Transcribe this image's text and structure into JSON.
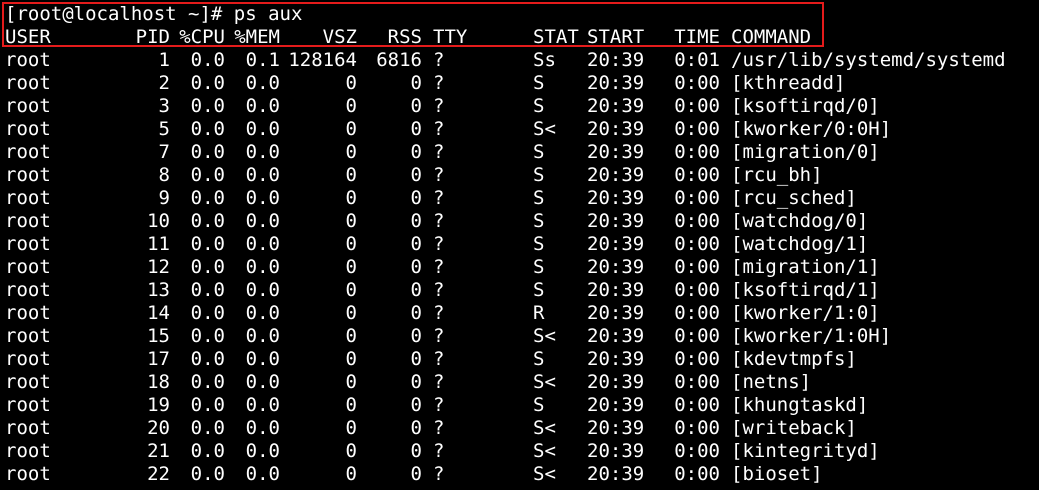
{
  "terminal": {
    "prompt": "[root@localhost ~]# ps aux",
    "headers": {
      "user": "USER",
      "pid": "PID",
      "cpu": "%CPU",
      "mem": "%MEM",
      "vsz": "VSZ",
      "rss": "RSS",
      "tty": "TTY",
      "stat": "STAT",
      "start": "START",
      "time": "TIME",
      "command": "COMMAND"
    },
    "rows": [
      {
        "user": "root",
        "pid": "1",
        "cpu": "0.0",
        "mem": "0.1",
        "vsz": "128164",
        "rss": "6816",
        "tty": "?",
        "stat": "Ss",
        "start": "20:39",
        "time": "0:01",
        "command": "/usr/lib/systemd/systemd"
      },
      {
        "user": "root",
        "pid": "2",
        "cpu": "0.0",
        "mem": "0.0",
        "vsz": "0",
        "rss": "0",
        "tty": "?",
        "stat": "S",
        "start": "20:39",
        "time": "0:00",
        "command": "[kthreadd]"
      },
      {
        "user": "root",
        "pid": "3",
        "cpu": "0.0",
        "mem": "0.0",
        "vsz": "0",
        "rss": "0",
        "tty": "?",
        "stat": "S",
        "start": "20:39",
        "time": "0:00",
        "command": "[ksoftirqd/0]"
      },
      {
        "user": "root",
        "pid": "5",
        "cpu": "0.0",
        "mem": "0.0",
        "vsz": "0",
        "rss": "0",
        "tty": "?",
        "stat": "S<",
        "start": "20:39",
        "time": "0:00",
        "command": "[kworker/0:0H]"
      },
      {
        "user": "root",
        "pid": "7",
        "cpu": "0.0",
        "mem": "0.0",
        "vsz": "0",
        "rss": "0",
        "tty": "?",
        "stat": "S",
        "start": "20:39",
        "time": "0:00",
        "command": "[migration/0]"
      },
      {
        "user": "root",
        "pid": "8",
        "cpu": "0.0",
        "mem": "0.0",
        "vsz": "0",
        "rss": "0",
        "tty": "?",
        "stat": "S",
        "start": "20:39",
        "time": "0:00",
        "command": "[rcu_bh]"
      },
      {
        "user": "root",
        "pid": "9",
        "cpu": "0.0",
        "mem": "0.0",
        "vsz": "0",
        "rss": "0",
        "tty": "?",
        "stat": "S",
        "start": "20:39",
        "time": "0:00",
        "command": "[rcu_sched]"
      },
      {
        "user": "root",
        "pid": "10",
        "cpu": "0.0",
        "mem": "0.0",
        "vsz": "0",
        "rss": "0",
        "tty": "?",
        "stat": "S",
        "start": "20:39",
        "time": "0:00",
        "command": "[watchdog/0]"
      },
      {
        "user": "root",
        "pid": "11",
        "cpu": "0.0",
        "mem": "0.0",
        "vsz": "0",
        "rss": "0",
        "tty": "?",
        "stat": "S",
        "start": "20:39",
        "time": "0:00",
        "command": "[watchdog/1]"
      },
      {
        "user": "root",
        "pid": "12",
        "cpu": "0.0",
        "mem": "0.0",
        "vsz": "0",
        "rss": "0",
        "tty": "?",
        "stat": "S",
        "start": "20:39",
        "time": "0:00",
        "command": "[migration/1]"
      },
      {
        "user": "root",
        "pid": "13",
        "cpu": "0.0",
        "mem": "0.0",
        "vsz": "0",
        "rss": "0",
        "tty": "?",
        "stat": "S",
        "start": "20:39",
        "time": "0:00",
        "command": "[ksoftirqd/1]"
      },
      {
        "user": "root",
        "pid": "14",
        "cpu": "0.0",
        "mem": "0.0",
        "vsz": "0",
        "rss": "0",
        "tty": "?",
        "stat": "R",
        "start": "20:39",
        "time": "0:00",
        "command": "[kworker/1:0]"
      },
      {
        "user": "root",
        "pid": "15",
        "cpu": "0.0",
        "mem": "0.0",
        "vsz": "0",
        "rss": "0",
        "tty": "?",
        "stat": "S<",
        "start": "20:39",
        "time": "0:00",
        "command": "[kworker/1:0H]"
      },
      {
        "user": "root",
        "pid": "17",
        "cpu": "0.0",
        "mem": "0.0",
        "vsz": "0",
        "rss": "0",
        "tty": "?",
        "stat": "S",
        "start": "20:39",
        "time": "0:00",
        "command": "[kdevtmpfs]"
      },
      {
        "user": "root",
        "pid": "18",
        "cpu": "0.0",
        "mem": "0.0",
        "vsz": "0",
        "rss": "0",
        "tty": "?",
        "stat": "S<",
        "start": "20:39",
        "time": "0:00",
        "command": "[netns]"
      },
      {
        "user": "root",
        "pid": "19",
        "cpu": "0.0",
        "mem": "0.0",
        "vsz": "0",
        "rss": "0",
        "tty": "?",
        "stat": "S",
        "start": "20:39",
        "time": "0:00",
        "command": "[khungtaskd]"
      },
      {
        "user": "root",
        "pid": "20",
        "cpu": "0.0",
        "mem": "0.0",
        "vsz": "0",
        "rss": "0",
        "tty": "?",
        "stat": "S<",
        "start": "20:39",
        "time": "0:00",
        "command": "[writeback]"
      },
      {
        "user": "root",
        "pid": "21",
        "cpu": "0.0",
        "mem": "0.0",
        "vsz": "0",
        "rss": "0",
        "tty": "?",
        "stat": "S<",
        "start": "20:39",
        "time": "0:00",
        "command": "[kintegrityd]"
      },
      {
        "user": "root",
        "pid": "22",
        "cpu": "0.0",
        "mem": "0.0",
        "vsz": "0",
        "rss": "0",
        "tty": "?",
        "stat": "S<",
        "start": "20:39",
        "time": "0:00",
        "command": "[bioset]"
      }
    ],
    "colors": {
      "background": "#000000",
      "text": "#ffffff",
      "highlight_border": "#e41b1b"
    }
  }
}
